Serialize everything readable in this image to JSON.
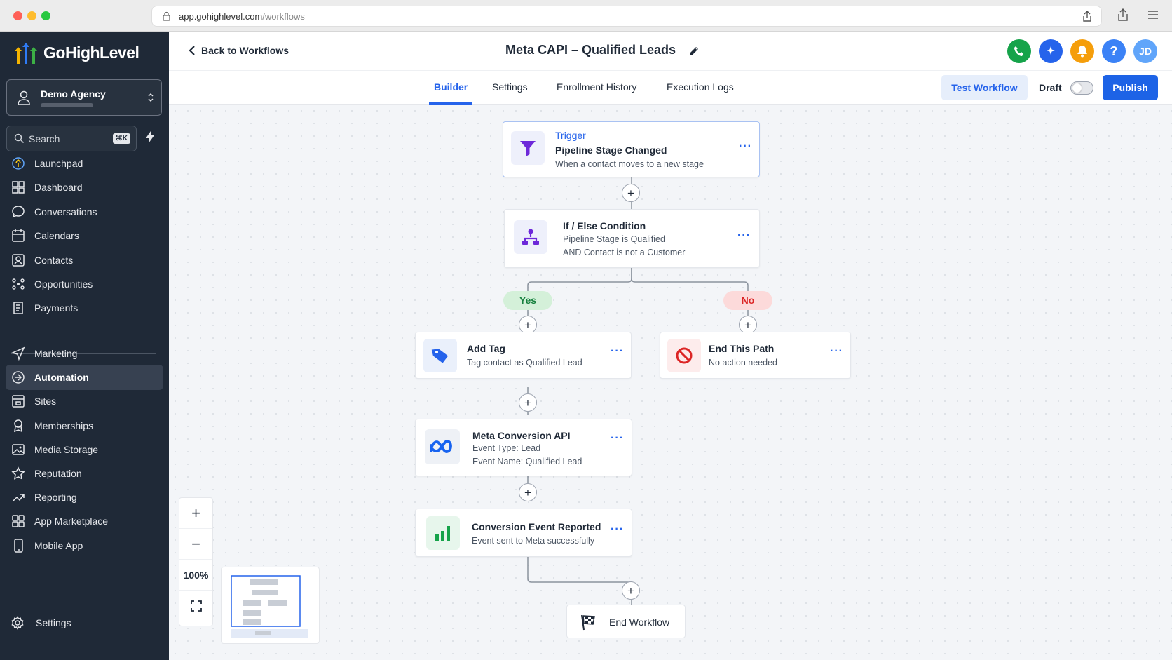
{
  "browser": {
    "url_domain": "app.gohighlevel.com",
    "url_path": "/workflows"
  },
  "brand": {
    "name": "GoHighLevel"
  },
  "agency": {
    "name": "Demo Agency"
  },
  "search": {
    "label": "Search",
    "shortcut": "⌘K"
  },
  "sidebar": {
    "items": [
      {
        "label": "Launchpad",
        "icon": "launchpad-icon"
      },
      {
        "label": "Dashboard",
        "icon": "dashboard-icon"
      },
      {
        "label": "Conversations",
        "icon": "chat-icon"
      },
      {
        "label": "Calendars",
        "icon": "calendar-icon"
      },
      {
        "label": "Contacts",
        "icon": "contacts-icon"
      },
      {
        "label": "Opportunities",
        "icon": "opportunities-icon"
      },
      {
        "label": "Payments",
        "icon": "payments-icon"
      }
    ],
    "items2": [
      {
        "label": "Marketing",
        "icon": "send-icon"
      },
      {
        "label": "Automation",
        "icon": "automation-icon",
        "active": true
      },
      {
        "label": "Sites",
        "icon": "sites-icon"
      },
      {
        "label": "Memberships",
        "icon": "memberships-icon"
      },
      {
        "label": "Media Storage",
        "icon": "media-icon"
      },
      {
        "label": "Reputation",
        "icon": "star-icon"
      },
      {
        "label": "Reporting",
        "icon": "reporting-icon"
      },
      {
        "label": "App Marketplace",
        "icon": "apps-icon"
      },
      {
        "label": "Mobile App",
        "icon": "mobile-icon"
      }
    ],
    "settings": "Settings"
  },
  "header": {
    "back": "Back to Workflows",
    "title": "Meta CAPI – Qualified Leads",
    "avatar": "JD",
    "colors": {
      "phone": "#16a34a",
      "ai": "#2563eb",
      "bell": "#f59e0b",
      "help": "#3b82f6",
      "avatar": "#60a5fa"
    }
  },
  "tabs": [
    "Builder",
    "Settings",
    "Enrollment History",
    "Execution Logs"
  ],
  "actions": {
    "test": "Test Workflow",
    "status": "Draft",
    "draft_enabled": false,
    "publish": "Publish"
  },
  "workflow": {
    "trigger": {
      "type": "Trigger",
      "title": "Pipeline Stage Changed",
      "desc": "When a contact moves to a new stage"
    },
    "condition": {
      "title": "If / Else Condition",
      "line1": "Pipeline Stage is Qualified",
      "line2": "AND Contact is not a Customer"
    },
    "yes": "Yes",
    "no": "No",
    "add_tag": {
      "title": "Add Tag",
      "desc": "Tag contact as Qualified Lead"
    },
    "end_path": {
      "title": "End This Path",
      "desc": "No action needed"
    },
    "meta": {
      "title": "Meta Conversion API",
      "line1": "Event Type: Lead",
      "line2": "Event Name: Qualified Lead"
    },
    "reported": {
      "title": "Conversion Event Reported",
      "desc": "Event sent to Meta successfully"
    },
    "end": "End Workflow"
  },
  "zoom": {
    "level": "100%"
  }
}
